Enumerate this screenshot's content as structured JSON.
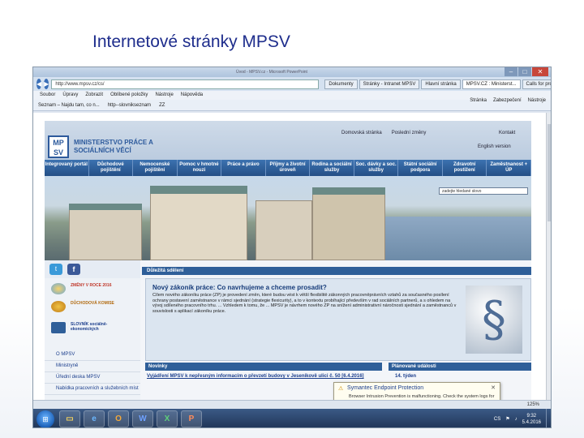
{
  "slide": {
    "title": "Internetové stránky MPSV"
  },
  "window": {
    "title": "Úvod - MPSV.cz - Microsoft PowerPoint",
    "controls": {
      "minimize": "–",
      "maximize": "□",
      "close": "✕"
    }
  },
  "browser": {
    "url": "http://www.mpsv.cz/cs/",
    "tabs": [
      "Dokumenty",
      "Stránky - Intranet MPSV",
      "Hlavní stránka",
      "MPSV.CZ : Ministerst...",
      "Calls for proposals - E..."
    ],
    "active_tab": 3,
    "menu": [
      "Soubor",
      "Úpravy",
      "Zobrazit",
      "Oblíbené položky",
      "Nástroje",
      "Nápověda"
    ],
    "favorites": [
      "Seznam – Najdu tam, co n...",
      "http--slovnikseznam",
      "ZZ"
    ],
    "commands": [
      "Stránka",
      "Zabezpečení",
      "Nástroje"
    ],
    "zoom": "125%"
  },
  "site": {
    "logo": {
      "mark": "MP SV",
      "name": "MINISTERSTVO PRÁCE A SOCIÁLNÍCH VĚCÍ"
    },
    "top_links": [
      "Domovská stránka",
      "Poslední změny"
    ],
    "contact": "Kontakt",
    "language": "English version",
    "nav": [
      "Integrovaný portál",
      "Důchodové pojištění",
      "Nemocenské pojištění",
      "Pomoc v hmotné nouzi",
      "Práce a právo",
      "Příjmy a životní úroveň",
      "Rodina a sociální služby",
      "Soc. dávky a soc. služby",
      "Státní sociální podpora",
      "Zdravotní postižení",
      "Zaměstnanost + ÚP"
    ],
    "search_placeholder": "zadejte hledané slovo",
    "sections": {
      "important": "Důležitá sdělení",
      "news": "Novinky",
      "events": "Plánované události"
    },
    "feature": {
      "title": "Nový zákoník práce: Co navrhujeme a chceme prosadit?",
      "text": "Cílem nového zákoníku práce (ZP) je provedení změn, které budou vést k větší flexibilitě zákonných pracovněprávních vztahů za současného posílení ochrany postavení zaměstnance v rámci sjednání (strategie flexicurity), a to v kontextu probíhající především v rad sociálních partnerů, a s ohledem na vývoj sdíleného pracovního trhu. ... Vzhledem k tomu, že ... MPSV je návrhem nového ZP na snížení administrativní náročnosti sjednání a zaměstnanců v souvislosti s aplikací zákoníku práce."
    },
    "promos": [
      {
        "icon": "zmeny-logo-icon",
        "label": "ZMĚNY V ROCE 2016"
      },
      {
        "icon": "duchodova-komise-icon",
        "label": "DŮCHODOVÁ KOMISE"
      },
      {
        "icon": "book-icon",
        "label": "SLOVNÍK sociálně-ekonomických"
      }
    ],
    "left_links": [
      "O MPSV",
      "Ministryně",
      "Úřední deska MPSV",
      "Nabídka pracovních a služebních míst"
    ],
    "news_item": "Vyjádření MPSV k nepřesným informacím o převzetí budovy v Jeseníkově ulici č. 50 [6.4.2016]",
    "event_item": "14. týden"
  },
  "popup": {
    "title": "Symantec Endpoint Protection",
    "message": "Browser Intrusion Prevention is malfunctioning. Check the system logs for details."
  },
  "taskbar": {
    "apps": [
      "Explorer",
      "Internet Explorer",
      "Outlook",
      "Word",
      "Excel",
      "PowerPoint"
    ],
    "app_glyphs": [
      "▭",
      "e",
      "O",
      "W",
      "X",
      "P"
    ],
    "lang": "CS",
    "time": "9:32",
    "date": "5.4.2016"
  },
  "colors": {
    "accent": "#2f5f99",
    "title": "#1e2d8c"
  }
}
